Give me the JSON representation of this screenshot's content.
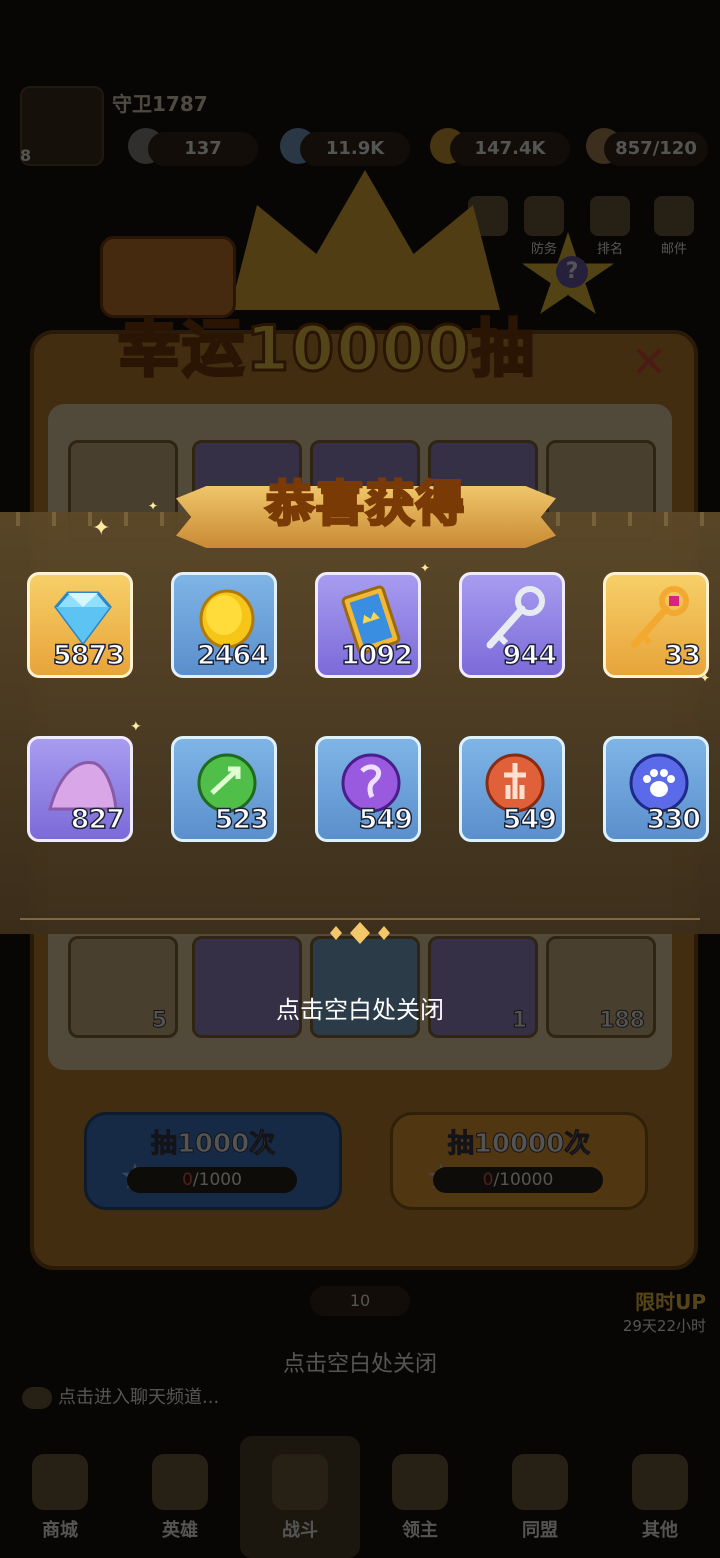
{
  "background": {
    "player_name": "守卫1787",
    "level": "8",
    "resources": [
      "137",
      "11.9K",
      "147.4K",
      "857/120"
    ],
    "side_buttons": [
      "",
      "防务",
      "排名",
      "邮件"
    ],
    "panel_title": "幸运10000抽",
    "grid_bottom_quantities": [
      "5",
      "",
      "",
      "1",
      "188"
    ],
    "draw_buttons": [
      {
        "label": "抽1000次",
        "progress_current": "0",
        "progress_total": "/1000"
      },
      {
        "label": "抽10000次",
        "progress_current": "0",
        "progress_total": "/10000"
      }
    ],
    "count_pill": "10",
    "event_title": "限时UP",
    "event_timer": "29天22小时",
    "close_hint": "点击空白处关闭",
    "chat_placeholder": "点击进入聊天频道...",
    "nav_items": [
      "商城",
      "英雄",
      "战斗",
      "领主",
      "同盟",
      "其他"
    ]
  },
  "overlay": {
    "title": "恭喜获得",
    "close_hint": "点击空白处关闭",
    "rewards": [
      {
        "icon": "diamond-icon",
        "quantity": "5873",
        "rarity": "gold"
      },
      {
        "icon": "gold-coin-icon",
        "quantity": "2464",
        "rarity": "blue"
      },
      {
        "icon": "ticket-icon",
        "quantity": "1092",
        "rarity": "purple"
      },
      {
        "icon": "silver-key-icon",
        "quantity": "944",
        "rarity": "purple"
      },
      {
        "icon": "golden-key-icon",
        "quantity": "33",
        "rarity": "gold"
      },
      {
        "icon": "purple-sand-icon",
        "quantity": "827",
        "rarity": "purple"
      },
      {
        "icon": "green-orb-icon",
        "quantity": "523",
        "rarity": "blue"
      },
      {
        "icon": "purple-orb-icon",
        "quantity": "549",
        "rarity": "blue"
      },
      {
        "icon": "red-orb-icon",
        "quantity": "549",
        "rarity": "blue"
      },
      {
        "icon": "paw-orb-icon",
        "quantity": "330",
        "rarity": "blue"
      }
    ]
  },
  "colors": {
    "tile_gold": "#e7a43a",
    "tile_blue": "#5a8fcc",
    "tile_purple": "#7c6ad8",
    "title_text": "#ffe24a"
  }
}
